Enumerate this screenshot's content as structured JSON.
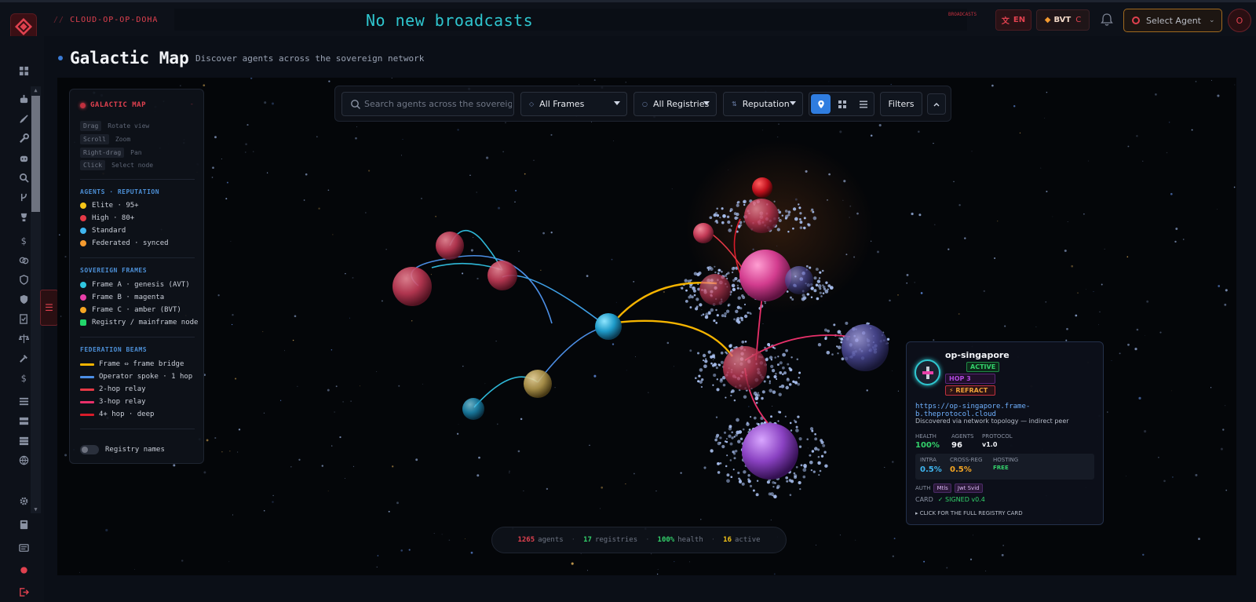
{
  "topbar": {
    "crumb_prefix": "//",
    "crumb": "CLOUD-OP-OP-DOHA",
    "ticker": "No new broadcasts",
    "broadcast_tag": "BROADCASTS",
    "lang_icon": "translate-icon",
    "lang": "EN",
    "token": "BVT",
    "token_sub": "C",
    "agent_select": "Select Agent",
    "avatar": "O"
  },
  "page": {
    "title": "Galactic Map",
    "subtitle": "Discover agents across the sovereign network"
  },
  "legend": {
    "title": "GALACTIC MAP",
    "minimize": "-",
    "controls": [
      {
        "key": "Drag",
        "action": "Rotate view"
      },
      {
        "key": "Scroll",
        "action": "Zoom"
      },
      {
        "key": "Right-drag",
        "action": "Pan"
      },
      {
        "key": "Click",
        "action": "Select node"
      }
    ],
    "reputation_head": "AGENTS · REPUTATION",
    "reputation": [
      {
        "label": "Elite · 95+",
        "color": "#f5c518"
      },
      {
        "label": "High · 80+",
        "color": "#e53946"
      },
      {
        "label": "Standard",
        "color": "#3fb6f0"
      },
      {
        "label": "Federated · synced",
        "color": "#f39a2f"
      }
    ],
    "frames_head": "SOVEREIGN FRAMES",
    "frames": [
      {
        "label": "Frame A · genesis (AVT)",
        "color": "#2fc6e0"
      },
      {
        "label": "Frame B · magenta",
        "color": "#e83fa8"
      },
      {
        "label": "Frame C · amber (BVT)",
        "color": "#f5a623"
      },
      {
        "label": "Registry / mainframe node",
        "color": "#22d66b"
      }
    ],
    "beams_head": "FEDERATION BEAMS",
    "beams": [
      {
        "label": "Frame ⇔ frame bridge",
        "color": "#f5b400"
      },
      {
        "label": "Operator spoke · 1 hop",
        "color": "#4c8fe6"
      },
      {
        "label": "2-hop relay",
        "color": "#e53946"
      },
      {
        "label": "3-hop relay",
        "color": "#e8306a"
      },
      {
        "label": "4+ hop · deep",
        "color": "#d81b2a"
      }
    ],
    "registry_toggle": "Registry names"
  },
  "toolbar": {
    "search_placeholder": "Search agents across the sovereign network",
    "frames": "All Frames",
    "registries": "All Registries",
    "sort": "Reputation",
    "filters": "Filters"
  },
  "status": {
    "agents": "1265",
    "agents_label": "agents",
    "registries": "17",
    "registries_label": "registries",
    "health": "100%",
    "health_label": "health",
    "active": "16",
    "active_label": "active"
  },
  "card": {
    "name": "op-singapore",
    "status": "ACTIVE",
    "hop": "HOP 3",
    "refract": "⚡ REFRACT",
    "url": "https://op-singapore.frame-b.theprotocol.cloud",
    "desc": "Discovered via network topology — indirect peer",
    "health_label": "HEALTH",
    "health": "100%",
    "agents_label": "AGENTS",
    "agents": "96",
    "protocol_label": "PROTOCOL",
    "protocol": "v1.0",
    "intra_label": "INTRA",
    "intra": "0.5%",
    "cross_label": "CROSS-REG",
    "cross": "0.5%",
    "hosting_label": "HOSTING",
    "hosting": "FREE",
    "auth_label": "AUTH",
    "auth": [
      "Mtls",
      "Jwt Svid"
    ],
    "card_label": "CARD",
    "card_status": "✓ SIGNED v0.4",
    "footer": "▸ CLICK FOR THE FULL REGISTRY CARD"
  },
  "colors": {
    "accent": "#e0414f",
    "ticker": "#2fc6cf",
    "primary_blue": "#2f7de0"
  }
}
